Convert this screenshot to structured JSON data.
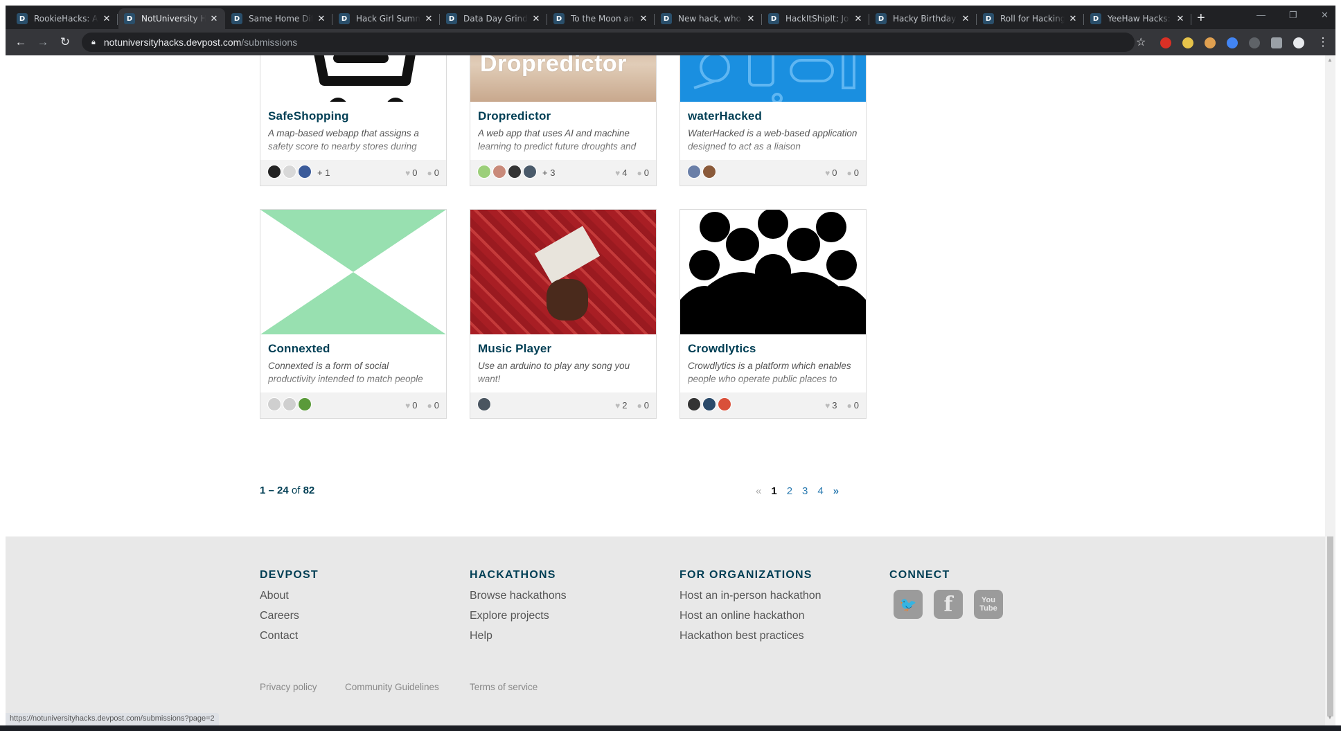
{
  "browser": {
    "tabs": [
      {
        "title": "RookieHacks: Att",
        "active": false
      },
      {
        "title": "NotUniversity Ha",
        "active": true
      },
      {
        "title": "Same Home Diffe",
        "active": false
      },
      {
        "title": "Hack Girl Summe",
        "active": false
      },
      {
        "title": "Data Day Grind: I",
        "active": false
      },
      {
        "title": "To the Moon and",
        "active": false
      },
      {
        "title": "New hack, who t",
        "active": false
      },
      {
        "title": "HackItShipIt: Join",
        "active": false
      },
      {
        "title": "Hacky Birthday h",
        "active": false
      },
      {
        "title": "Roll for Hacking:",
        "active": false
      },
      {
        "title": "YeeHaw Hacks: V",
        "active": false
      }
    ],
    "favicon_letter": "D",
    "url_host": "notuniversityhacks.devpost.com",
    "url_path": "/submissions",
    "status_url": "https://notuniversityhacks.devpost.com/submissions?page=2"
  },
  "projects": [
    {
      "title": "SafeShopping",
      "tagline": "A map-based webapp that assigns a safety score to nearby stores during",
      "extra_members": "+ 1",
      "likes": "0",
      "comments": "0",
      "image": "shopping-cart",
      "avatar_colors": [
        "#222",
        "#d8d8d8",
        "#3b5b9a"
      ]
    },
    {
      "title": "Dropredictor",
      "tagline": "A web app that uses AI and machine learning to predict future droughts and",
      "image_text": "Dropredictor",
      "extra_members": "+ 3",
      "likes": "4",
      "comments": "0",
      "image": "dry-earth",
      "avatar_colors": [
        "#9ccf7a",
        "#c98a7a",
        "#333",
        "#4a5a6a"
      ]
    },
    {
      "title": "waterHacked",
      "tagline": "WaterHacked is a web-based application designed to act as a liaison",
      "extra_members": "",
      "likes": "0",
      "comments": "0",
      "image": "blue-tech-icons",
      "avatar_colors": [
        "#6a7fa8",
        "#8a5a3a"
      ]
    },
    {
      "title": "Connexted",
      "tagline": "Connexted is a form of social productivity intended to match people",
      "extra_members": "",
      "likes": "0",
      "comments": "0",
      "image": "green-x",
      "avatar_colors": [
        "#cfcfcf",
        "#cfcfcf",
        "#5a9a3a"
      ]
    },
    {
      "title": "Music Player",
      "tagline": "Use an arduino to play any song you want!",
      "extra_members": "",
      "likes": "2",
      "comments": "0",
      "image": "arduino-photo",
      "avatar_colors": [
        "#4a5560"
      ]
    },
    {
      "title": "Crowdlytics",
      "tagline": "Crowdlytics is a platform which enables people who operate public places to",
      "extra_members": "",
      "likes": "3",
      "comments": "0",
      "image": "crowd-silhouette",
      "avatar_colors": [
        "#333",
        "#2a4a6a",
        "#d9503a"
      ]
    }
  ],
  "pagination": {
    "range": "1 – 24",
    "of_word": "of",
    "total": "82",
    "prev": "«",
    "pages": [
      "1",
      "2",
      "3",
      "4"
    ],
    "current": "1",
    "next": "»"
  },
  "footer": {
    "columns": [
      {
        "heading": "DEVPOST",
        "links": [
          "About",
          "Careers",
          "Contact"
        ]
      },
      {
        "heading": "HACKATHONS",
        "links": [
          "Browse hackathons",
          "Explore projects",
          "Help"
        ]
      },
      {
        "heading": "FOR ORGANIZATIONS",
        "links": [
          "Host an in-person hackathon",
          "Host an online hackathon",
          "Hackathon best practices"
        ]
      },
      {
        "heading": "CONNECT",
        "links": []
      }
    ],
    "social": [
      {
        "icon": "twitter-icon",
        "glyph": "🐦"
      },
      {
        "icon": "facebook-icon",
        "glyph": "f"
      },
      {
        "icon": "youtube-icon",
        "glyph": "You Tube"
      }
    ],
    "legal": [
      "Privacy policy",
      "Community Guidelines",
      "Terms of service"
    ]
  }
}
